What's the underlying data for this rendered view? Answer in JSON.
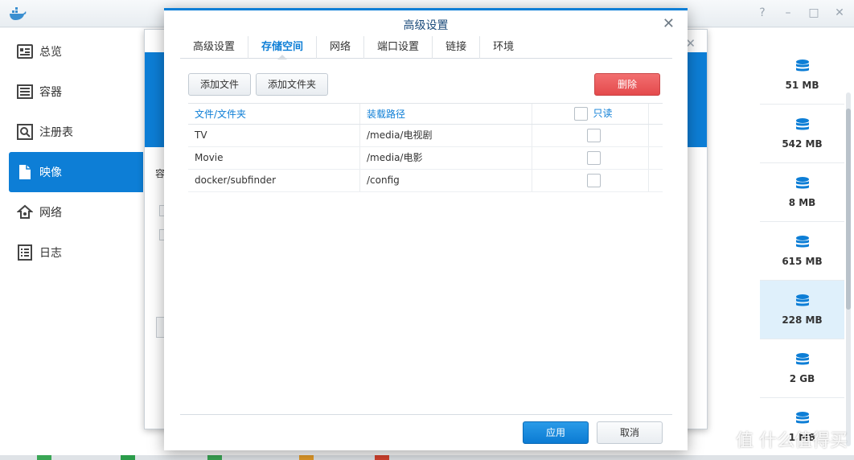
{
  "sidebar": {
    "items": [
      {
        "label": "总览",
        "icon": "overview-icon"
      },
      {
        "label": "容器",
        "icon": "container-icon"
      },
      {
        "label": "注册表",
        "icon": "registry-icon"
      },
      {
        "label": "映像",
        "icon": "image-icon",
        "active": true
      },
      {
        "label": "网络",
        "icon": "network-icon"
      },
      {
        "label": "日志",
        "icon": "log-icon"
      }
    ]
  },
  "image_sizes": [
    "51 MB",
    "542 MB",
    "8 MB",
    "615 MB",
    "228 MB",
    "2 GB",
    "1 MB"
  ],
  "background_dialog": {
    "text": "容",
    "close_glyph": "✕"
  },
  "dialog": {
    "title": "高级设置",
    "close_glyph": "✕",
    "tabs": [
      "高级设置",
      "存储空间",
      "网络",
      "端口设置",
      "链接",
      "环境"
    ],
    "active_tab": "存储空间",
    "toolbar": {
      "add_file": "添加文件",
      "add_folder": "添加文件夹",
      "delete": "删除"
    },
    "table": {
      "headers": {
        "file_folder": "文件/文件夹",
        "mount_path": "装载路径",
        "read_only": "只读"
      },
      "rows": [
        {
          "file": "TV",
          "path": "/media/电视剧",
          "read_only": false
        },
        {
          "file": "Movie",
          "path": "/media/电影",
          "read_only": false
        },
        {
          "file": "docker/subfinder",
          "path": "/config",
          "read_only": false
        }
      ]
    },
    "footer": {
      "apply": "应用",
      "cancel": "取消"
    }
  },
  "watermark": {
    "text": "值 什么值得买"
  },
  "colors": {
    "accent": "#0d7ed6",
    "danger": "#e44a4c",
    "highlight_row": "#dff0fb"
  }
}
